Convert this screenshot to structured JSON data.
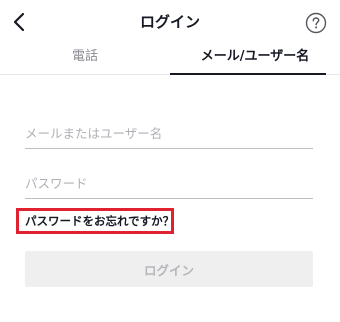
{
  "header": {
    "title": "ログイン",
    "back_icon": "chevron-left-icon",
    "help_icon": "question-circle-icon"
  },
  "tabs": [
    {
      "label": "電話",
      "active": false
    },
    {
      "label": "メール/ユーザー名",
      "active": true
    }
  ],
  "form": {
    "username_placeholder": "メールまたはユーザー名",
    "username_value": "",
    "password_placeholder": "パスワード",
    "password_value": "",
    "forgot_label": "パスワードをお忘れですか？",
    "login_label": "ログイン"
  },
  "colors": {
    "highlight_box": "#e0212f",
    "disabled_button_bg": "#efeff0",
    "disabled_button_text": "#b5b6ba"
  }
}
